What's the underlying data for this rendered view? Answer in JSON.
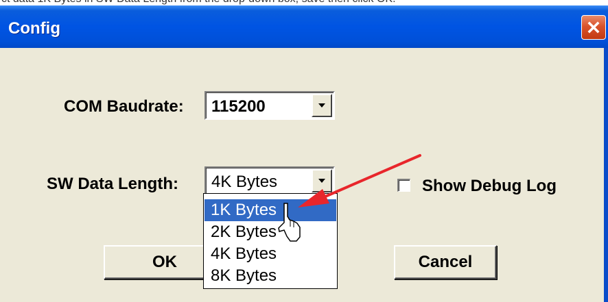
{
  "top_strip_text": "ct data 1K Bytes in SW Data Length from the drop-down box, save then click OK.",
  "dialog": {
    "title": "Config",
    "close_icon": "close-icon"
  },
  "fields": {
    "com_baudrate": {
      "label": "COM Baudrate:",
      "value": "115200"
    },
    "sw_data_length": {
      "label": "SW Data Length:",
      "value": "4K Bytes"
    }
  },
  "dropdown": {
    "options": [
      "1K Bytes",
      "2K Bytes",
      "4K Bytes",
      "8K Bytes"
    ],
    "highlighted": "1K Bytes"
  },
  "checkbox": {
    "label": "Show Debug Log",
    "checked": false
  },
  "buttons": {
    "ok": "OK",
    "cancel": "Cancel"
  },
  "annotation": {
    "arrow_color": "#e8262b",
    "cursor": "hand-pointer-cursor"
  },
  "colors": {
    "title_bar": "#0054e3",
    "dialog_bg": "#ece9d8",
    "selection": "#316ac5",
    "close_button": "#d9532c"
  }
}
